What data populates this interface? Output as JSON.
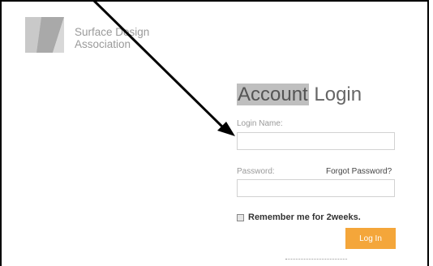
{
  "brand": {
    "name_line1": "Surface Design",
    "name_line2": "Association"
  },
  "login": {
    "title_highlight": "Account",
    "title_rest": "Login",
    "login_name_label": "Login Name:",
    "login_name_value": "",
    "password_label": "Password:",
    "password_value": "",
    "forgot_password": "Forgot Password?",
    "remember_label": "Remember me for 2weeks.",
    "remember_checked": false,
    "login_button": "Log In"
  },
  "annotation": {
    "icon": "arrow-annotation-icon",
    "color": "#000000"
  },
  "colors": {
    "accent": "#f4a63a",
    "highlight": "#bfbfbf",
    "muted_text": "#9a9a9a"
  }
}
